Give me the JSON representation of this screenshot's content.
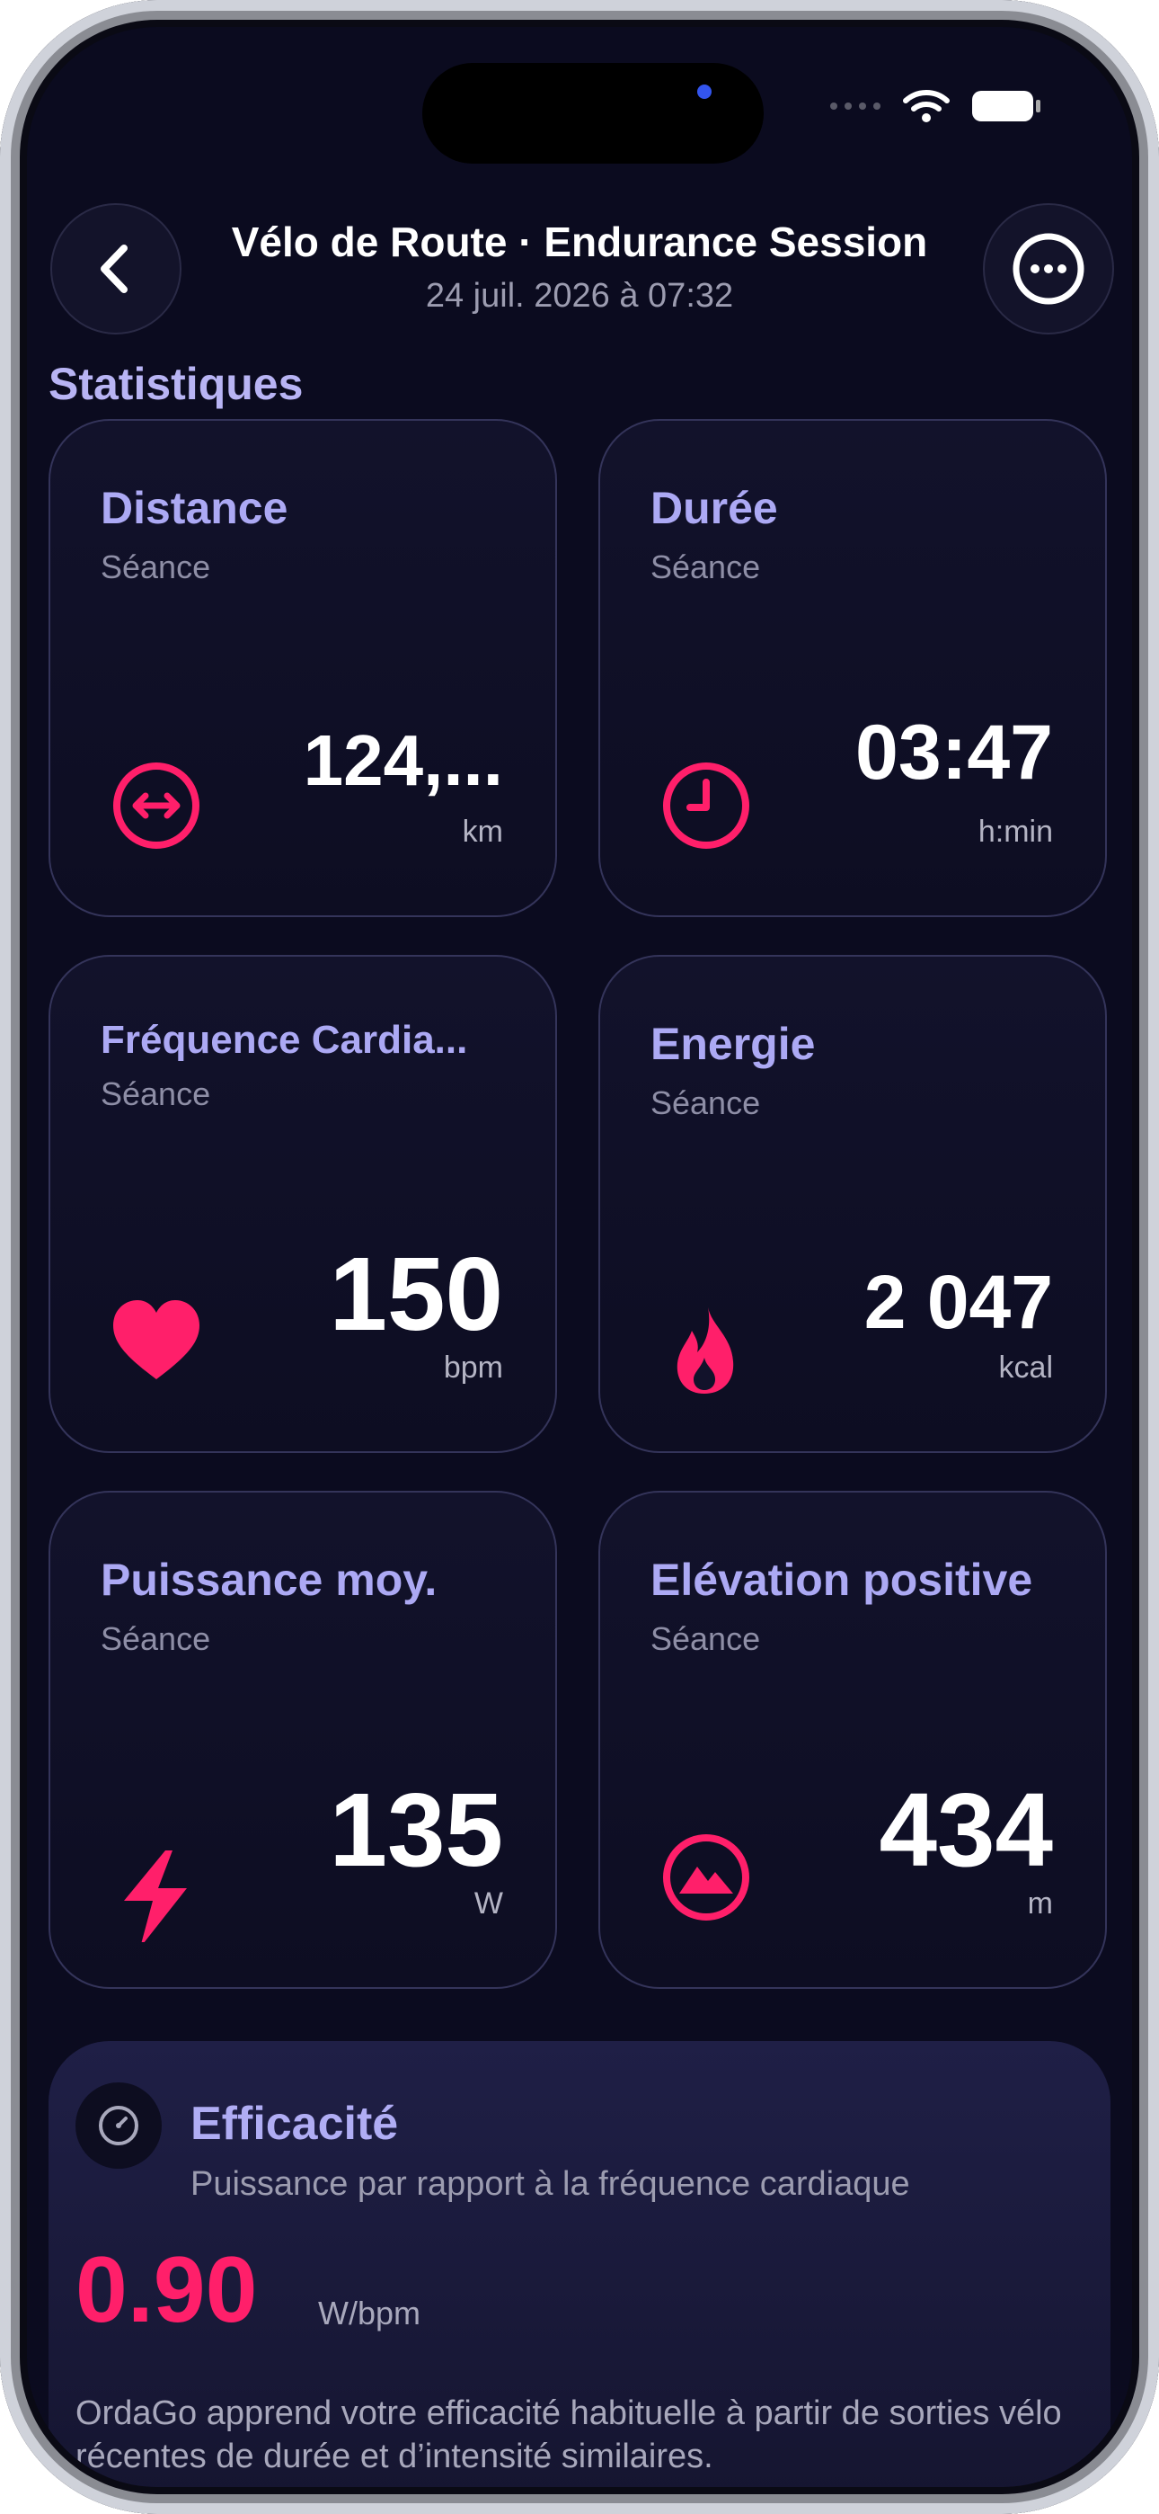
{
  "header": {
    "title": "Vélo de Route · Endurance Session",
    "subtitle": "24 juil. 2026 à 07:32"
  },
  "section": {
    "title": "Statistiques"
  },
  "cards": [
    {
      "label": "Distance",
      "sub": "Séance",
      "value": "124,...",
      "unit": "km",
      "icon": "arrows-left-right-icon"
    },
    {
      "label": "Durée",
      "sub": "Séance",
      "value": "03:47",
      "unit": "h:min",
      "icon": "clock-icon"
    },
    {
      "label": "Fréquence Cardia...",
      "sub": "Séance",
      "value": "150",
      "unit": "bpm",
      "icon": "heart-icon"
    },
    {
      "label": "Energie",
      "sub": "Séance",
      "value": "2 047",
      "unit": "kcal",
      "icon": "flame-icon"
    },
    {
      "label": "Puissance moy.",
      "sub": "Séance",
      "value": "135",
      "unit": "W",
      "icon": "lightning-bolt-icon"
    },
    {
      "label": "Elévation positive",
      "sub": "Séance",
      "value": "434",
      "unit": "m",
      "icon": "mountain-icon"
    }
  ],
  "efficiency": {
    "title": "Efficacité",
    "description": "Puissance par rapport à la fréquence cardiaque",
    "value": "0.90",
    "unit": "W/bpm",
    "note": "OrdaGo apprend votre efficacité habituelle à partir de sorties vélo récentes de durée et d’intensité similaires.",
    "progress": 0.78
  },
  "colors": {
    "accent": "#ff1f6a",
    "label": "#aca9f4",
    "background": "#0b0b1f"
  }
}
